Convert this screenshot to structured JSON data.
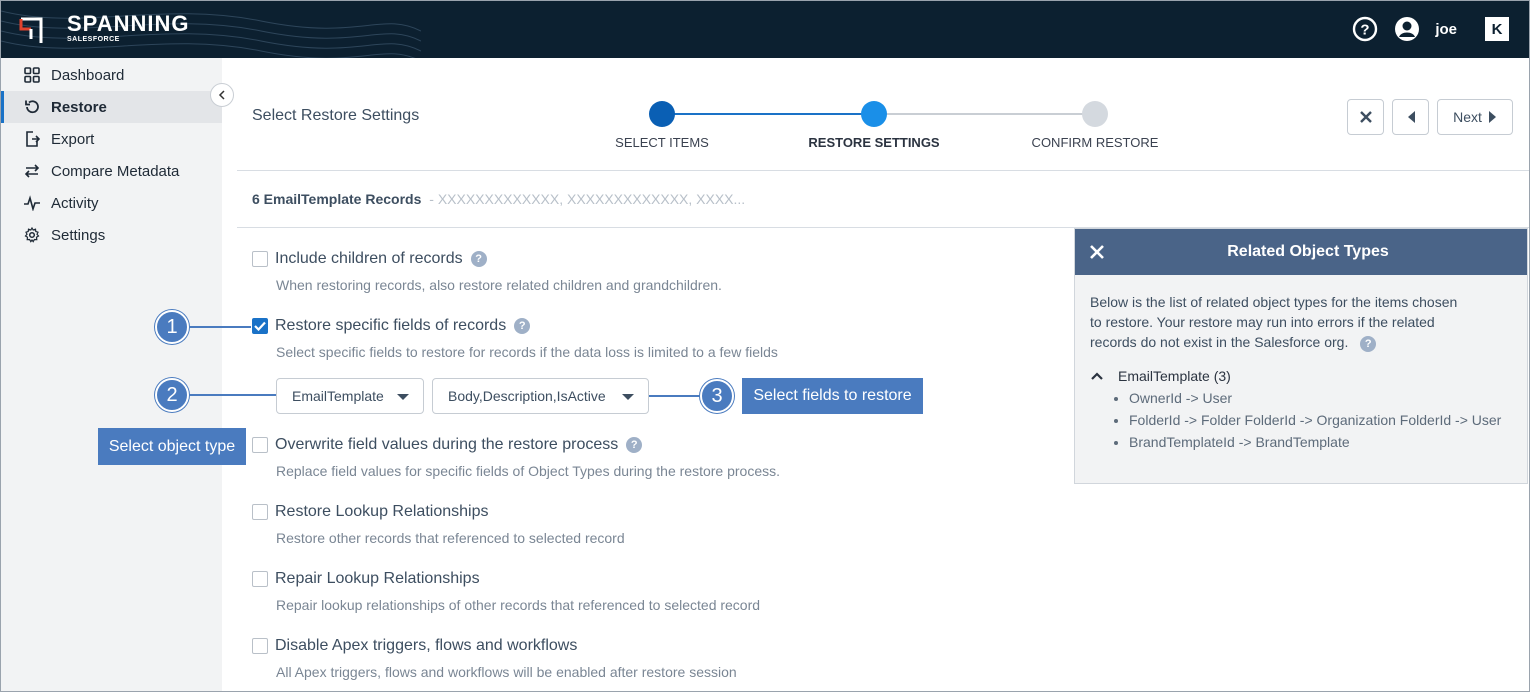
{
  "app": {
    "brand": "SPANNING",
    "brand_sub": "SALESFORCE",
    "user": "joe"
  },
  "sidebar": {
    "items": [
      {
        "label": "Dashboard",
        "icon": "dashboard-icon"
      },
      {
        "label": "Restore",
        "icon": "restore-icon"
      },
      {
        "label": "Export",
        "icon": "export-icon"
      },
      {
        "label": "Compare Metadata",
        "icon": "compare-icon"
      },
      {
        "label": "Activity",
        "icon": "activity-icon"
      },
      {
        "label": "Settings",
        "icon": "gear-icon"
      }
    ],
    "active": "Restore"
  },
  "main": {
    "title": "Select Restore Settings",
    "steps": [
      {
        "label": "SELECT ITEMS",
        "state": "done"
      },
      {
        "label": "RESTORE SETTINGS",
        "state": "current"
      },
      {
        "label": "CONFIRM RESTORE",
        "state": "pending"
      }
    ],
    "next_label": "Next",
    "records_count": "6 EmailTemplate Records",
    "records_ids": "- XXXXXXXXXXXXX, XXXXXXXXXXXXX, XXXX...",
    "options": [
      {
        "label": "Include children of records",
        "desc": "When restoring records, also restore related children and grandchildren.",
        "checked": false,
        "help": true
      },
      {
        "label": "Restore specific fields of records",
        "desc": "Select specific fields to restore for records if the data loss is limited to a few fields",
        "checked": true,
        "help": true
      },
      {
        "label": "Overwrite field values during the restore process",
        "desc": "Replace field values for specific fields of Object Types during the restore process.",
        "checked": false,
        "help": true
      },
      {
        "label": "Restore Lookup Relationships",
        "desc": "Restore other records that referenced to selected record",
        "checked": false,
        "help": false
      },
      {
        "label": "Repair Lookup Relationships",
        "desc": "Repair lookup relationships of other records that referenced to selected record",
        "checked": false,
        "help": false
      },
      {
        "label": "Disable Apex triggers, flows and workflows",
        "desc": "All Apex triggers, flows and workflows will be enabled after restore session",
        "checked": false,
        "help": false
      }
    ],
    "object_select": "EmailTemplate",
    "fields_select": "Body,Description,IsActive",
    "help_glyph": "?"
  },
  "annotations": {
    "callouts": [
      "1",
      "2",
      "3"
    ],
    "object_tag": "Select object type",
    "fields_tag": "Select fields to restore"
  },
  "related_panel": {
    "title": "Related Object Types",
    "intro": "Below is the list of related object types for the items chosen to restore. Your restore may run into errors if the related records do not exist in the Salesforce org.",
    "group": "EmailTemplate (3)",
    "items": [
      "OwnerId -> User",
      "FolderId -> Folder FolderId -> Organization FolderId -> User",
      "BrandTemplateId -> BrandTemplate"
    ]
  },
  "colors": {
    "header_bg": "#0c2030",
    "accent": "#1a72c7",
    "annotation": "#4a7bbf",
    "panel_header": "#4a6488"
  }
}
